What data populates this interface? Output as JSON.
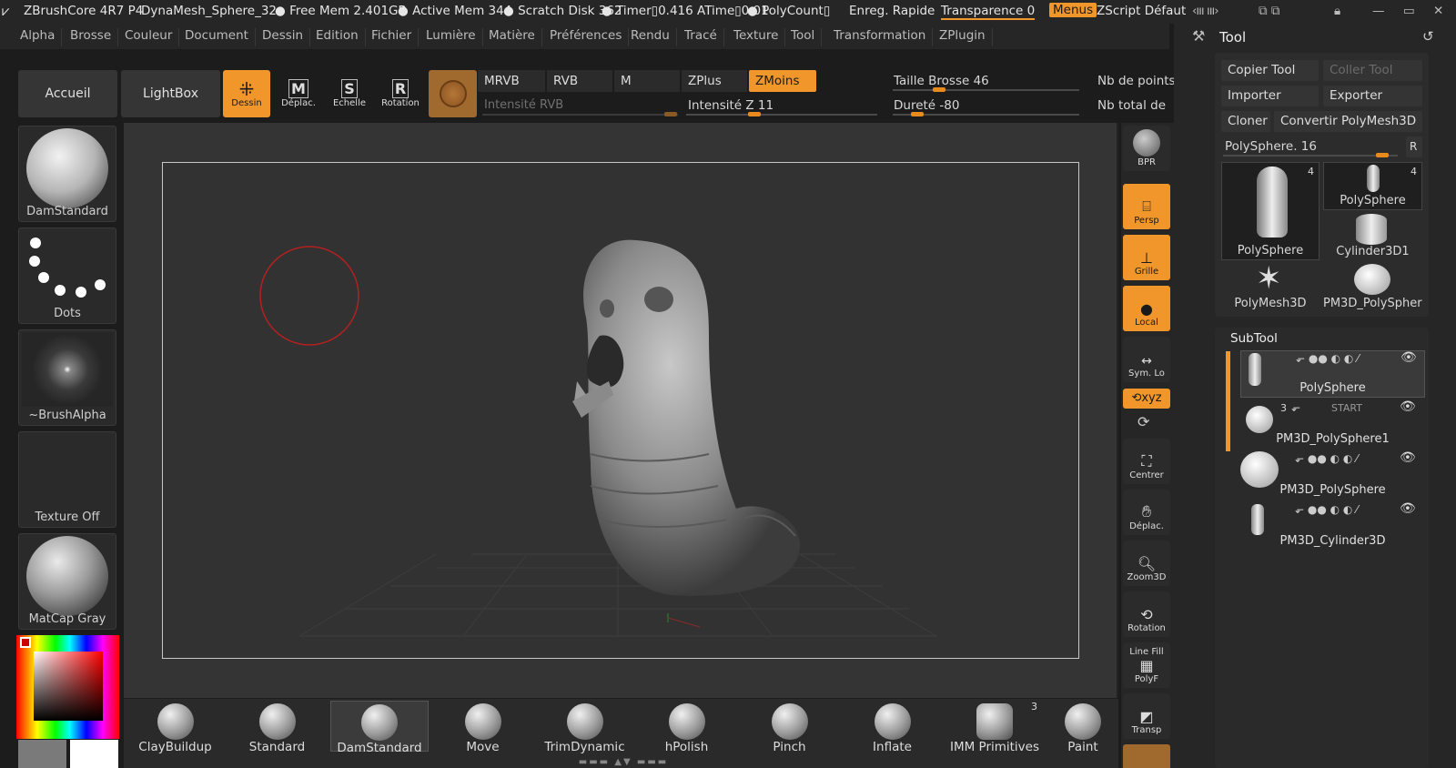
{
  "titlebar": {
    "app": "ZBrushCore 4R7 P4",
    "doc": "DynaMesh_Sphere_32",
    "free_mem": "● Free Mem 2.401GB",
    "active_mem": "● Active Mem 344",
    "scratch": "● Scratch Disk 362",
    "timer": "●  Timer▯0.416 ATime▯0.01",
    "polycount": "● PolyCount▯",
    "save": "Enreg. Rapide",
    "transparence": "Transparence 0",
    "menus": "Menus",
    "zscript": "ZScript Défaut"
  },
  "menubar": [
    "Alpha",
    "Brosse",
    "Couleur",
    "Document",
    "Dessin",
    "Edition",
    "Fichier",
    "Lumière",
    "Matière",
    "Préférences",
    "Rendu",
    "Tracé",
    "Texture",
    "Tool",
    "Transformation",
    "ZPlugin"
  ],
  "shelf": {
    "accueil": "Accueil",
    "lightbox": "LightBox",
    "dessin": "Dessin",
    "deplac": "Déplac.",
    "echelle": "Echelle",
    "rotation": "Rotation",
    "mrvb": "MRVB",
    "rvb": "RVB",
    "m": "M",
    "zplus": "ZPlus",
    "zmoins": "ZMoins",
    "intensite_rvb": "Intensité RVB",
    "intensite_z": "Intensité Z 11",
    "taille": "Taille Brosse 46",
    "durete": "Dureté -80",
    "nb_points": "Nb de points",
    "nb_total": "Nb total de p"
  },
  "left_panel": {
    "brush": "DamStandard",
    "stroke": "Dots",
    "alpha": "~BrushAlpha",
    "texture": "Texture Off",
    "material": "MatCap Gray"
  },
  "right_toolbar": {
    "bpr": "BPR",
    "persp": "Persp",
    "grille": "Grille",
    "local": "Local",
    "sym": "Sym. Lo",
    "xyz": "xyz",
    "centrer": "Centrer",
    "deplac": "Déplac.",
    "zoom": "Zoom3D",
    "rotation": "Rotation",
    "linefill": "Line Fill",
    "polyf": "PolyF",
    "transp": "Transp"
  },
  "tool_panel": {
    "title": "Tool",
    "copier": "Copier Tool",
    "coller": "Coller Tool",
    "importer": "Importer",
    "exporter": "Exporter",
    "cloner": "Cloner",
    "convertir": "Convertir PolyMesh3D",
    "polysphere_slider": "PolySphere. 16",
    "r_btn": "R",
    "thumbs": [
      {
        "name": "PolySphere",
        "count": "4"
      },
      {
        "name": "PolySphere",
        "count": "4"
      },
      {
        "name": "Cylinder3D1",
        "count": ""
      },
      {
        "name": "PolyMesh3D",
        "count": ""
      },
      {
        "name": "PM3D_PolySphere",
        "count": ""
      }
    ],
    "subtool_title": "SubTool",
    "subtools": [
      {
        "name": "PolySphere",
        "badge": ""
      },
      {
        "name": "PM3D_PolySphere1",
        "badge": "3"
      },
      {
        "name": "PM3D_PolySphere",
        "badge": ""
      },
      {
        "name": "PM3D_Cylinder3D",
        "badge": ""
      }
    ],
    "start": "START"
  },
  "brushes": [
    {
      "name": "ClayBuildup"
    },
    {
      "name": "Standard"
    },
    {
      "name": "DamStandard"
    },
    {
      "name": "Move"
    },
    {
      "name": "TrimDynamic"
    },
    {
      "name": "hPolish"
    },
    {
      "name": "Pinch"
    },
    {
      "name": "Inflate"
    },
    {
      "name": "IMM Primitives",
      "badge": "3"
    },
    {
      "name": "Paint"
    }
  ],
  "colors": {
    "accent": "#f0962a",
    "bg": "#1c1c1c",
    "panel": "#2b2b2b"
  }
}
